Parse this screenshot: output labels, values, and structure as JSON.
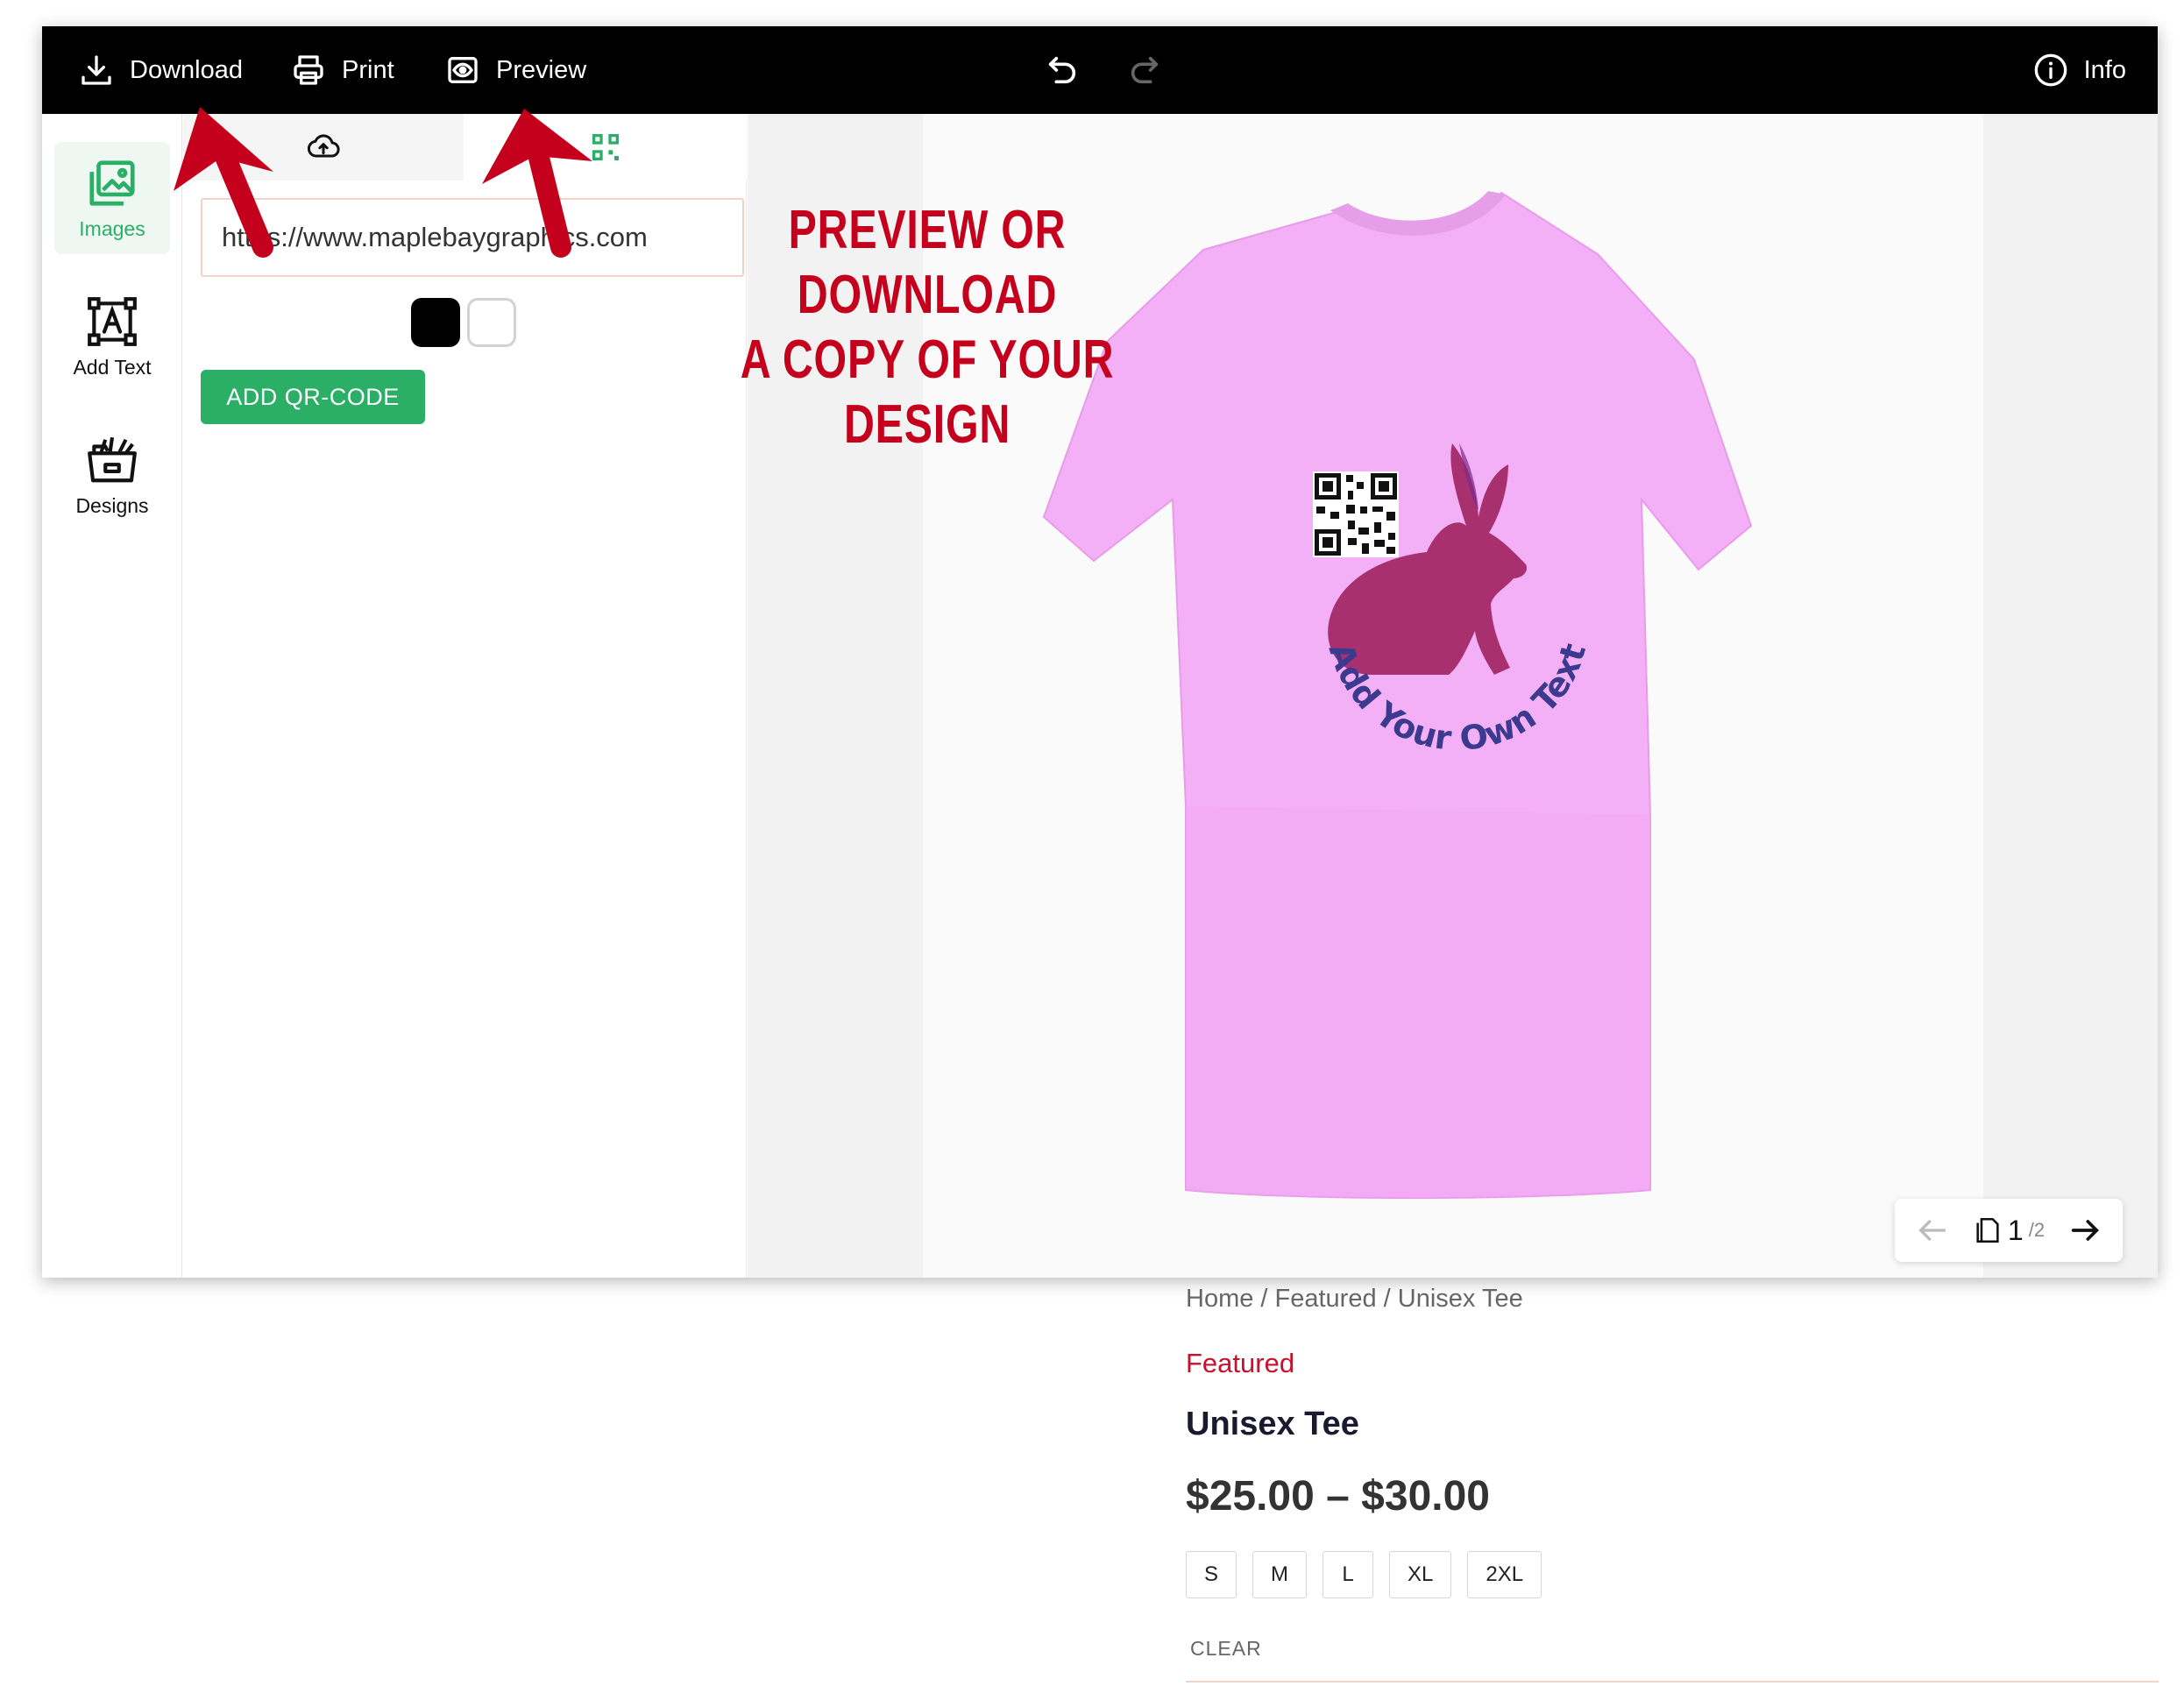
{
  "toolbar": {
    "download_label": "Download",
    "print_label": "Print",
    "preview_label": "Preview",
    "info_label": "Info"
  },
  "rail": {
    "images_label": "Images",
    "add_text_label": "Add Text",
    "designs_label": "Designs"
  },
  "panel": {
    "qr_input_value": "https://www.maplebaygraphics.com",
    "add_qr_label": "ADD QR-CODE"
  },
  "canvas": {
    "curved_text": "Add Your Own Text",
    "shirt_color": "#f4b0f6",
    "rabbit_color": "#a8306f",
    "text_color": "#3b3a8e"
  },
  "pager": {
    "current": "1",
    "total": "/2"
  },
  "annotation": {
    "line1": "PREVIEW OR DOWNLOAD",
    "line2": "A COPY OF YOUR",
    "line3": "DESIGN",
    "color": "#c5001d"
  },
  "product": {
    "breadcrumb": "Home / Featured / Unisex Tee",
    "category": "Featured",
    "title": "Unisex Tee",
    "price": "$25.00 – $30.00",
    "sizes": [
      "S",
      "M",
      "L",
      "XL",
      "2XL"
    ],
    "clear_label": "CLEAR"
  },
  "colors": {
    "accent_green": "#2bae66",
    "toolbar_bg": "#000000",
    "category_red": "#c8102e"
  }
}
